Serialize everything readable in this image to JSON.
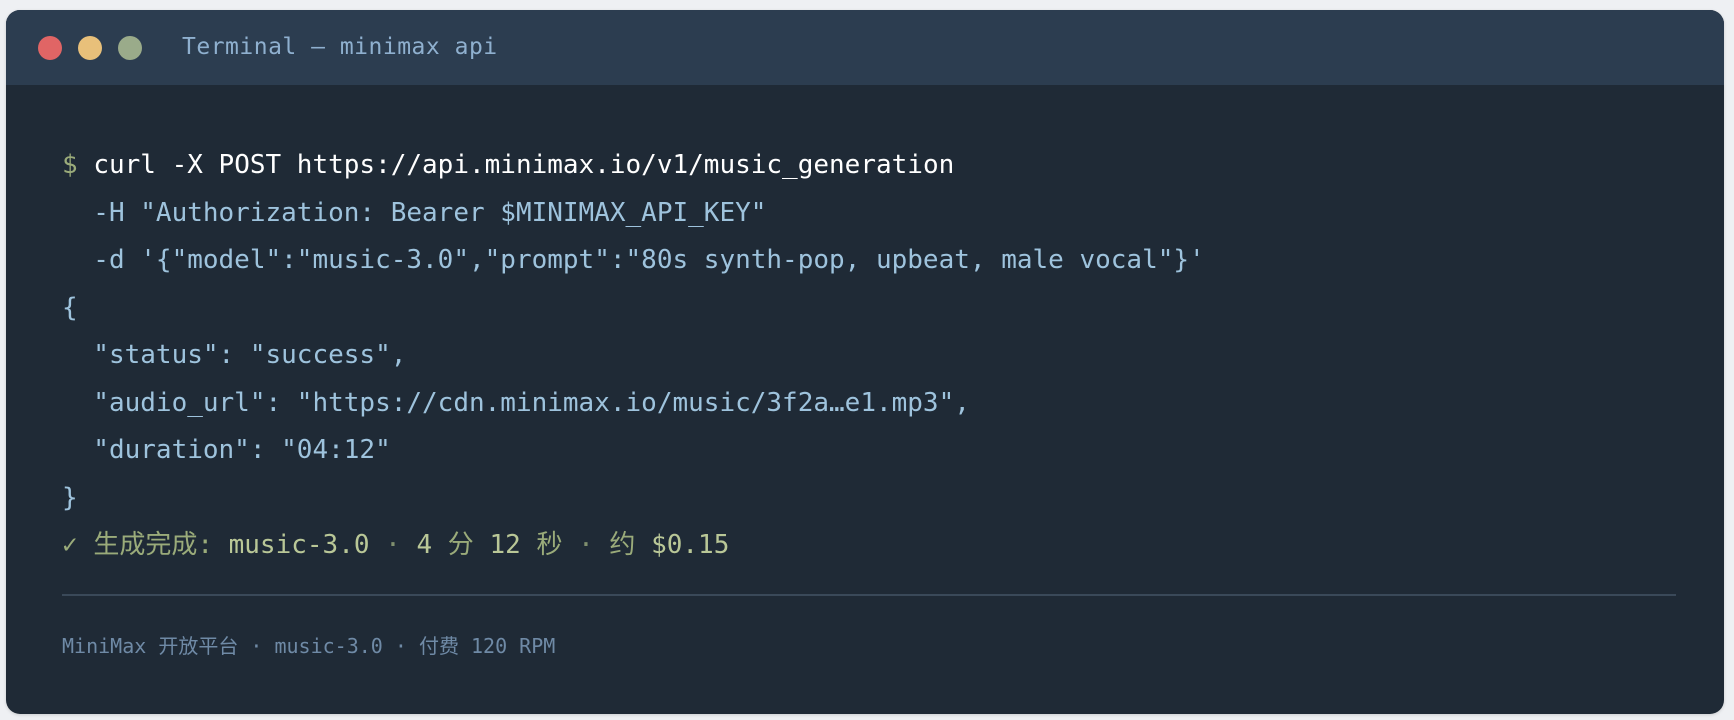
{
  "window": {
    "title": "Terminal — minimax api"
  },
  "terminal": {
    "prompt": "$",
    "command": "curl -X POST https://api.minimax.io/v1/music_generation",
    "header_line": "  -H \"Authorization: Bearer $MINIMAX_API_KEY\"",
    "data_line": "  -d '{\"model\":\"music-3.0\",\"prompt\":\"80s synth-pop, upbeat, male vocal\"}'",
    "json_open": "{",
    "status_line": "  \"status\": \"success\",",
    "audio_line": "  \"audio_url\": \"https://cdn.minimax.io/music/3f2a…e1.mp3\",",
    "duration_line": "  \"duration\": \"04:12\"",
    "json_close": "}",
    "result": {
      "check": "✓",
      "label": "生成完成:",
      "model": "music-3.0",
      "sep1": "·",
      "minutes": "4",
      "min_unit": "分",
      "seconds": "12",
      "sec_unit": "秒",
      "sep2": "·",
      "approx": "约",
      "cost": "$0.15"
    }
  },
  "footer": {
    "text": "MiniMax 开放平台 · music-3.0 · 付费 120 RPM"
  },
  "colors": {
    "window_bg": "#1f2a36",
    "titlebar_bg": "#2c3d50",
    "text": "#9ec3dd",
    "command": "#ffffff",
    "success": "#9aab7a",
    "close": "#e06565",
    "minimize": "#e8c07a",
    "maximize": "#9aab8a"
  }
}
